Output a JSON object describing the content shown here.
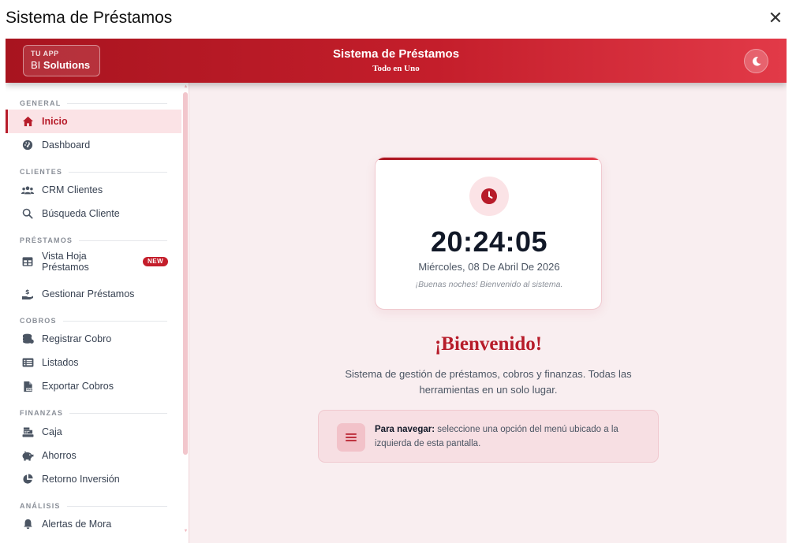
{
  "dialog": {
    "title": "Sistema de Préstamos",
    "close": "✕"
  },
  "header": {
    "brand_sub": "TU APP",
    "brand_prefix": "BI",
    "brand_name": "Solutions",
    "title": "Sistema de Préstamos",
    "subtitle": "Todo en Uno"
  },
  "sidebar": {
    "sections": {
      "general": "GENERAL",
      "clientes": "CLIENTES",
      "prestamos": "PRÉSTAMOS",
      "cobros": "COBROS",
      "finanzas": "FINANZAS",
      "analisis": "ANÁLISIS"
    },
    "items": {
      "inicio": "Inicio",
      "dashboard": "Dashboard",
      "crm": "CRM Clientes",
      "busqueda": "Búsqueda Cliente",
      "vista_hoja_1": "Vista Hoja",
      "vista_hoja_2": "Préstamos",
      "new_badge": "NEW",
      "gestionar": "Gestionar Préstamos",
      "registrar": "Registrar Cobro",
      "listados": "Listados",
      "exportar": "Exportar Cobros",
      "caja": "Caja",
      "ahorros": "Ahorros",
      "retorno": "Retorno Inversión",
      "alertas": "Alertas de Mora"
    }
  },
  "clock": {
    "time": "20:24:05",
    "date": "Miércoles, 08 De Abril De 2026",
    "greeting": "¡Buenas noches! Bienvenido al sistema."
  },
  "welcome": {
    "title": "¡Bienvenido!",
    "description": "Sistema de gestión de préstamos, cobros y finanzas. Todas las herramientas en un solo lugar."
  },
  "nav_hint": {
    "label": "Para navegar:",
    "text": " seleccione una opción del menú ubicado a la izquierda de esta pantalla."
  },
  "colors": {
    "primary": "#b71c2a",
    "header_start": "#a8141f",
    "header_end": "#e23a48",
    "background": "#f9eef0"
  }
}
